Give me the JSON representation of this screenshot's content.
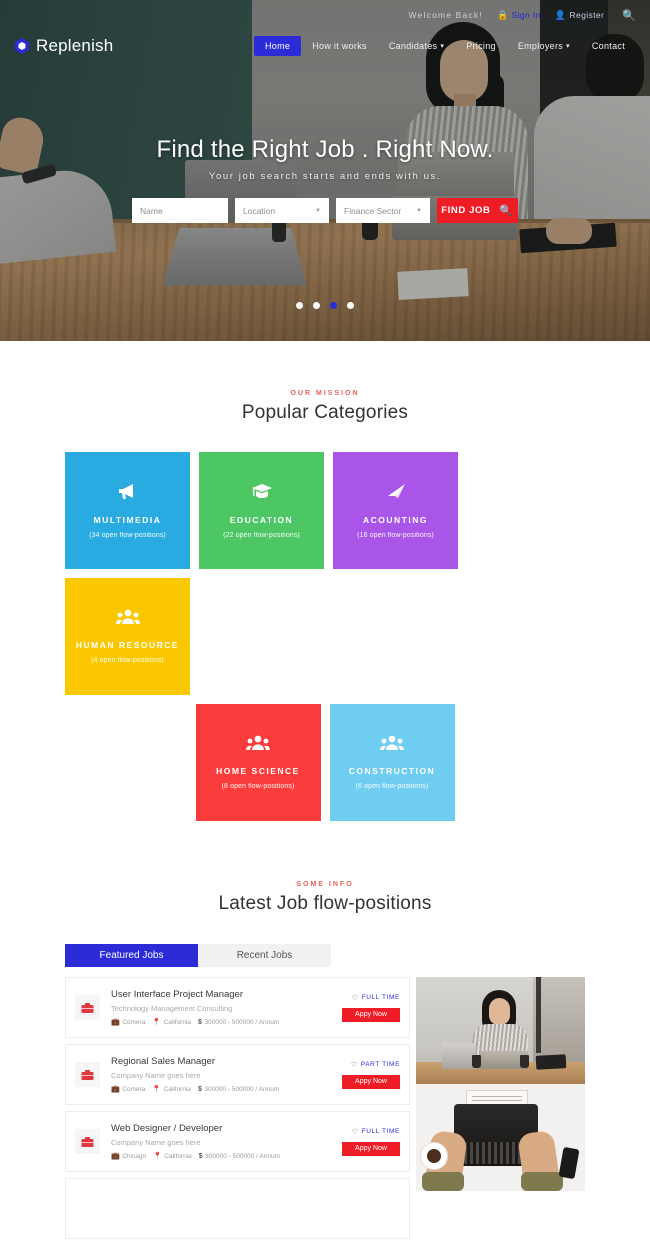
{
  "topbar": {
    "welcome": "Welcome Back!",
    "signin_label": "Sign In",
    "signin_icon": "lock-icon",
    "register_label": "Register",
    "register_icon": "user-icon",
    "search_icon": "search-icon"
  },
  "brand": {
    "name": "Replenish",
    "logo_icon": "hexagon-logo-icon"
  },
  "nav": {
    "items": [
      {
        "label": "Home",
        "active": true,
        "caret": ""
      },
      {
        "label": "How it works",
        "active": false,
        "caret": ""
      },
      {
        "label": "Candidates",
        "active": false,
        "caret": "▾"
      },
      {
        "label": "Pricing",
        "active": false,
        "caret": ""
      },
      {
        "label": "Employers",
        "active": false,
        "caret": "▾"
      },
      {
        "label": "Contact",
        "active": false,
        "caret": ""
      }
    ]
  },
  "hero": {
    "title": "Find the Right Job . Right Now.",
    "subtitle": "Your job search starts and ends with us.",
    "search": {
      "name_placeholder": "Name",
      "location_value": "Location",
      "sector_value": "Finance Sector",
      "button_label": "FIND JOB",
      "button_icon": "search-icon",
      "dropdown_icon": "caret-down-icon"
    },
    "carousel": {
      "total": 4,
      "active_index": 2
    }
  },
  "categories_section": {
    "eyebrow": "OUR MISSION",
    "title": "Popular Categories",
    "tiles": [
      {
        "name": "MULTIMEDIA",
        "count": "(34 open flow-positions)",
        "color": "#29abe2",
        "icon": "megaphone-icon"
      },
      {
        "name": "EDUCATION",
        "count": "(22 open flow-positions)",
        "color": "#4cc764",
        "icon": "graduation-cap-icon"
      },
      {
        "name": "ACOUNTING",
        "count": "(16 open flow-positions)",
        "color": "#a855e8",
        "icon": "paper-plane-icon"
      },
      {
        "name": "HUMAN RESOURCE",
        "count": "(4 open flow-positions)",
        "color": "#fbc800",
        "icon": "users-icon"
      },
      {
        "name": "HOME SCIENCE",
        "count": "(8 open flow-positions)",
        "color": "#fa3c3c",
        "icon": "users-icon"
      },
      {
        "name": "CONSTRUCTION",
        "count": "(6 open flow-positions)",
        "color": "#6fcdf2",
        "icon": "users-icon"
      }
    ]
  },
  "jobs_section": {
    "eyebrow": "SOME INFO",
    "title": "Latest Job flow-positions",
    "tabs": [
      {
        "label": "Featured Jobs",
        "active": true
      },
      {
        "label": "Recent Jobs",
        "active": false
      }
    ],
    "apply_label": "Appy Now",
    "cards": [
      {
        "title": "User Interface Project Manager",
        "company_line": "Technology Management Consulting",
        "company": "Comera",
        "location": "California",
        "salary": "300000 - 500000 / Annum",
        "type": "FULL TIME",
        "logo_icon": "briefcase-icon",
        "type_icon": "heart-icon"
      },
      {
        "title": "Regional Sales Manager",
        "company_line": "Company Name goes here",
        "company": "Comera",
        "location": "California",
        "salary": "300000 - 500000 / Annum",
        "type": "PART TIME",
        "logo_icon": "briefcase-icon",
        "type_icon": "heart-icon"
      },
      {
        "title": "Web Designer / Developer",
        "company_line": "Company Name goes here",
        "company": "Chicago",
        "location": "California",
        "salary": "300000 - 500000 / Annum",
        "type": "FULL TIME",
        "logo_icon": "briefcase-icon",
        "type_icon": "heart-icon"
      }
    ],
    "meta_icons": {
      "company": "briefcase-icon",
      "location": "map-pin-icon",
      "salary": "$"
    },
    "side_images": [
      {
        "alt": "woman-at-desk-with-laptop-photo"
      },
      {
        "alt": "hands-typing-on-typewriter-photo"
      }
    ]
  },
  "colors": {
    "brand_blue": "#2b2bd8",
    "accent_red": "#ee1c25",
    "eyebrow_red": "#e8615a"
  }
}
